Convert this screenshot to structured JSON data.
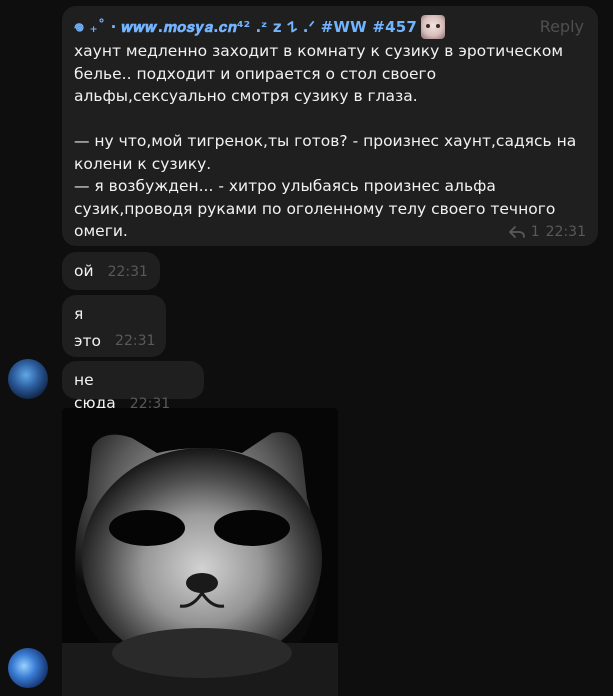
{
  "messages": [
    {
      "header": "𖦹 ₊˚ ‧ 𝒘𝒘𝒘.𝒎𝒐𝒔𝒚𝒂.𝒄𝒏⁴² ․ᶻ z 𐰁 .ᐟ #WW #457",
      "reply_label": "Reply",
      "text": "хаунт медленно заходит в комнату к сузику в эротическом белье.. подходит и опирается о стол своего альфы,сексуально смотря сузику в глаза.\n\n— ну что,мой тигренок,ты готов? - произнес хаунт,садясь на колени к сузику.\n— я возбужден... - хитро улыбаясь произнес альфа сузик,проводя руками по оголенному телу своего течного омеги.",
      "reply_count": "1",
      "time": "22:31"
    },
    {
      "text": "ой",
      "time": "22:31"
    },
    {
      "line1": "я",
      "line2": "это",
      "time": "22:31"
    },
    {
      "text": "не сюда",
      "time": "22:31"
    }
  ],
  "icons": {
    "sticker": "cat-sticker-icon",
    "reply": "reply-arrow-icon"
  },
  "colors": {
    "background": "#0e0e0e",
    "bubble": "#1f1f1f",
    "header_link": "#72b4ff",
    "meta": "#595959"
  }
}
